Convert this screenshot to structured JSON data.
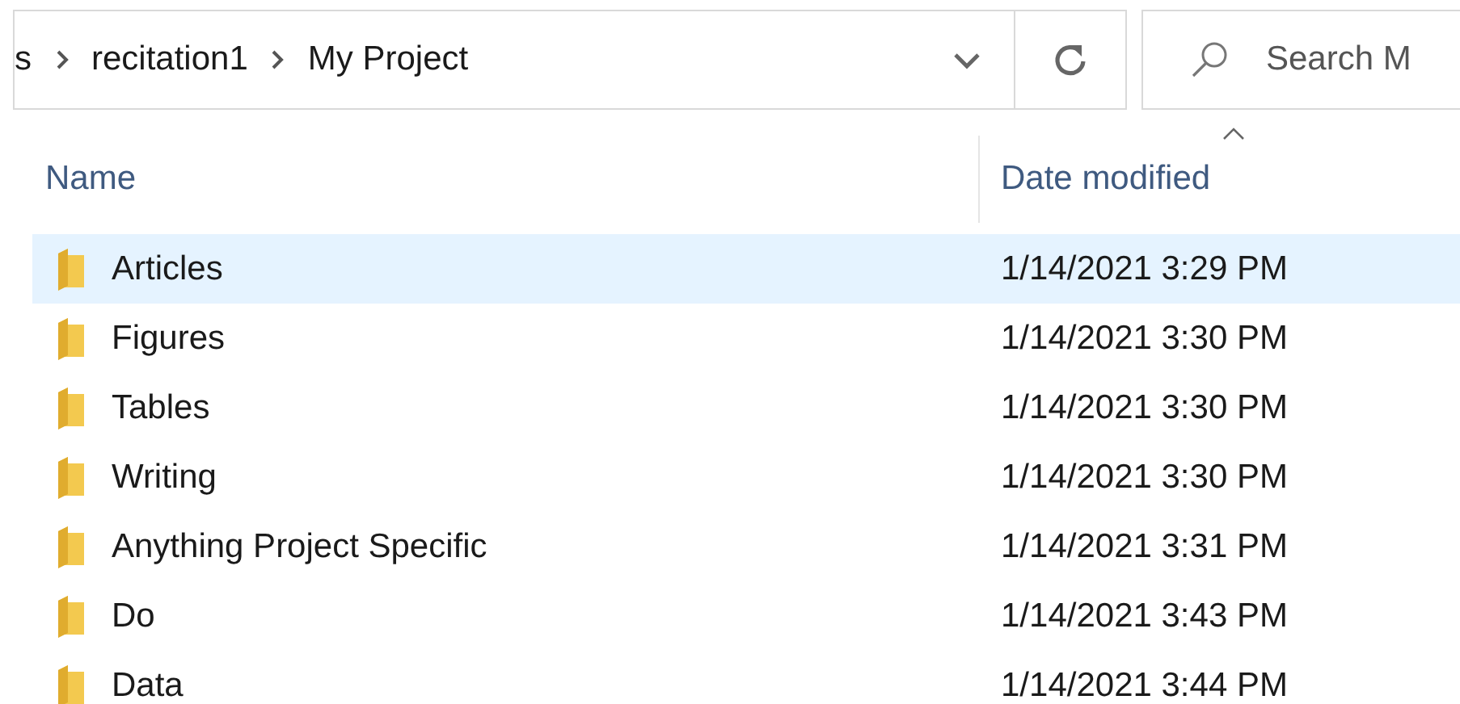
{
  "address_bar": {
    "breadcrumbs": [
      "s",
      "recitation1",
      "My Project"
    ]
  },
  "search": {
    "placeholder": "Search M"
  },
  "table": {
    "columns": [
      {
        "label": "Name",
        "sorted": false
      },
      {
        "label": "Date modified",
        "sorted": true
      }
    ],
    "rows": [
      {
        "name": "Articles",
        "date": "1/14/2021 3:29 PM",
        "selected": true
      },
      {
        "name": "Figures",
        "date": "1/14/2021 3:30 PM",
        "selected": false
      },
      {
        "name": "Tables",
        "date": "1/14/2021 3:30 PM",
        "selected": false
      },
      {
        "name": "Writing",
        "date": "1/14/2021 3:30 PM",
        "selected": false
      },
      {
        "name": "Anything Project Specific",
        "date": "1/14/2021 3:31 PM",
        "selected": false
      },
      {
        "name": "Do",
        "date": "1/14/2021 3:43 PM",
        "selected": false
      },
      {
        "name": "Data",
        "date": "1/14/2021 3:44 PM",
        "selected": false
      }
    ]
  }
}
